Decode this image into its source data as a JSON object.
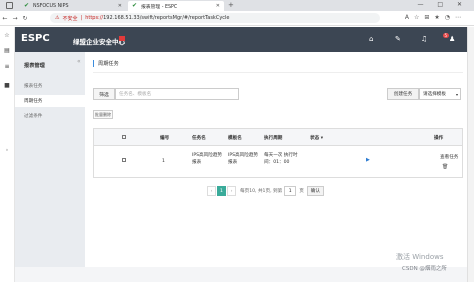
{
  "browser": {
    "tabs": [
      {
        "label": "NSFOCUS NIPS"
      },
      {
        "label": "报表管理 - ESPC"
      }
    ],
    "new_tab": "+",
    "window_controls": "—  □  ✕",
    "address": {
      "warning": "⚠",
      "not_secure": "不安全",
      "separator": "|",
      "protocol": "https://",
      "rest": "192.168.51.33/swift/reportsMgr/#/reportTaskCycle"
    },
    "nav_icons": [
      "←",
      "→",
      "↻"
    ],
    "right_icons": "A☆⊞★◔⋯"
  },
  "header": {
    "logo": "ESPC",
    "title": "绿盟企业安全中心",
    "badge": "5",
    "icons": [
      "home-icon",
      "edit-icon",
      "bell-icon",
      "user-icon",
      "menu-icon"
    ]
  },
  "sidebar": {
    "title": "报表管理",
    "collapse": "«",
    "items": [
      {
        "label": "报表任务"
      },
      {
        "label": "周期任务"
      },
      {
        "label": "过滤条件"
      }
    ]
  },
  "main": {
    "page_title": "周期任务",
    "filter_label": "筛选",
    "search_placeholder": "任务名、模板名",
    "create_button": "创建任务",
    "template_select": "请选择模板",
    "template_caret": "▾",
    "batch_delete": "批量删除",
    "table": {
      "headers": [
        "",
        "编号",
        "任务名",
        "模板名",
        "执行周期",
        "状态 ▾",
        "操作"
      ],
      "rows": [
        {
          "id": "1",
          "task_name": "IPS高风险趋势报表",
          "template_name": "IPS高风险趋势报表",
          "cycle": "每天一次 执行时间：01：00",
          "status_icon": "▶",
          "action_view": "查看任务",
          "action_delete": "🗑"
        }
      ]
    },
    "pager": {
      "prev": "‹",
      "current": "1",
      "next": "›",
      "info": "每页10, 共1页, 到第",
      "input": "1",
      "unit": "页",
      "go": "确认"
    }
  },
  "overlay": {
    "activate": "激活 Windows",
    "watermark": "CSDN @烟雨之所"
  }
}
